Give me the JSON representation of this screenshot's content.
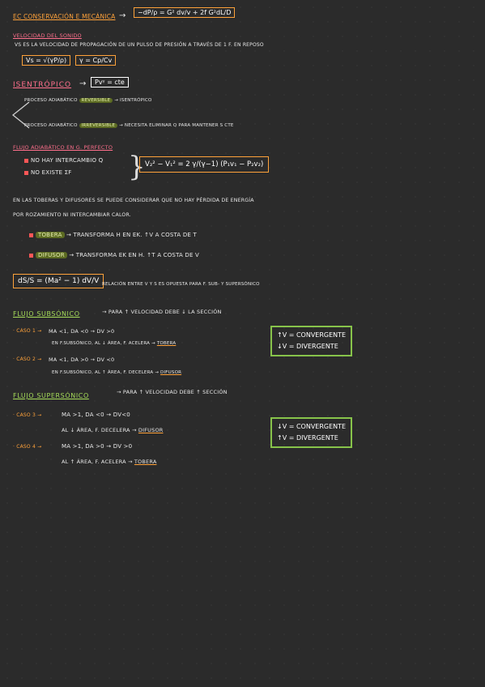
{
  "title": {
    "label": "EC CONSERVACIÓN E MECÁNICA",
    "arrow": "→",
    "equation": "−dP/ρ = G² dv/v + 2f G²dL/D"
  },
  "velocidad_sonido": {
    "heading": "VELOCIDAD DEL SONIDO",
    "line": "Vs ES LA VELOCIDAD DE PROPAGACIÓN DE UN PULSO DE PRESIÓN A TRAVÉS DE 1 F. EN REPOSO",
    "formula_vs": "Vs = √(γP/ρ)",
    "formula_gamma": "γ = Cp/Cv"
  },
  "isentropico": {
    "label": "ISENTRÓPICO",
    "arrow": "→",
    "formula": "Pvᵞ = cte",
    "reversible_line_a": "PROCESO ADIABÁTICO",
    "reversible_word": "REVERSIBLE",
    "reversible_line_b": "→ ISENTRÓPICO",
    "irreversible_line_a": "PROCESO ADIABÁTICO",
    "irreversible_word": "IRREVERSIBLE",
    "irreversible_line_b": "→ NECESITA ELIMINAR Q PARA MANTENER S CTE"
  },
  "flujo_adiabatico": {
    "heading": "FLUJO ADIABÁTICO EN G. PERFECTO",
    "cond_1": "NO HAY INTERCAMBIO Q",
    "cond_2": "NO EXISTE ΣF",
    "formula": "V₂² − V₁² = 2 γ/(γ−1) (P₁v₁ − P₂v₂)"
  },
  "toberas": {
    "line_1": "EN LAS TOBERAS Y DIFUSORES SE PUEDE CONSIDERAR QUE NO HAY PÉRDIDA DE ENERGÍA",
    "line_2": "POR ROZAMIENTO NI INTERCAMBIAR CALOR.",
    "tobera_word": "TOBERA",
    "tobera_desc": "→ TRANSFORMA H EN Ek. ↑V A COSTA DE T",
    "difusor_word": "DIFUSOR",
    "difusor_desc": "→ TRANSFORMA Ek EN H. ↑T A COSTA DE V"
  },
  "relacion": {
    "formula": "dS/S = (Ma² − 1) dV/V",
    "text": "RELACIÓN ENTRE V Y S ES OPUESTA PARA F. SUB- Y SUPERSÓNICO"
  },
  "subsonico": {
    "heading": "FLUJO SUBSÓNICO",
    "heading_rest": "→ PARA ↑ VELOCIDAD DEBE ↓ LA SECCIÓN",
    "caso1_label": "· CASO 1 →",
    "caso1_cond": "Ma <1, dA <0 → dV >0",
    "caso1_desc": "EN F.SUBSÓNICO, AL ↓ ÁREA, F. ACELERA →",
    "caso1_result": "TOBERA",
    "caso2_label": "· CASO 2 →",
    "caso2_cond": "Ma <1, dA >0 → dV <0",
    "caso2_desc": "EN F.SUBSÓNICO, AL ↑ ÁREA, F. DECELERA →",
    "caso2_result": "DIFUSOR",
    "box_line_1": "↑V = CONVERGENTE",
    "box_line_2": "↓V = DIVERGENTE"
  },
  "supersonico": {
    "heading": "FLUJO SUPERSÓNICO",
    "heading_rest": "→ PARA ↑ VELOCIDAD DEBE ↑ SECCIÓN",
    "caso3_label": "· CASO 3 →",
    "caso3_cond": "Ma >1, dA <0 → dV<0",
    "caso3_desc": "AL ↓ ÁREA, F. DECELERA →",
    "caso3_result": "DIFUSOR",
    "caso4_label": "· CASO 4 →",
    "caso4_cond": "Ma >1, dA >0 → dV >0",
    "caso4_desc": "AL ↑ ÁREA, F. ACELERA →",
    "caso4_result": "TOBERA",
    "box_line_1": "↓V = CONVERGENTE",
    "box_line_2": "↑V = DIVERGENTE"
  }
}
